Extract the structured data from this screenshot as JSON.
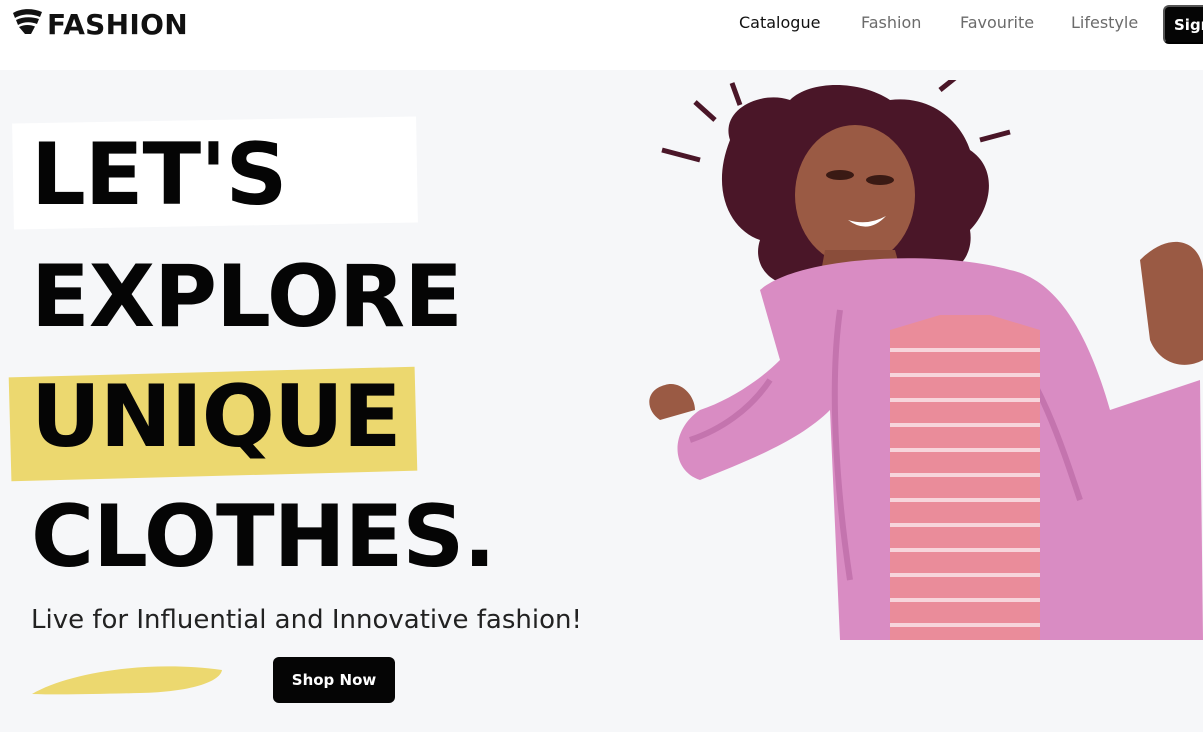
{
  "brand": {
    "name": "FASHION"
  },
  "nav": {
    "links": [
      {
        "label": "Catalogue",
        "active": true
      },
      {
        "label": "Fashion",
        "active": false
      },
      {
        "label": "Favourite",
        "active": false
      },
      {
        "label": "Lifestyle",
        "active": false
      }
    ],
    "signup_label": "Sign Up"
  },
  "hero": {
    "headline": [
      "LET'S",
      "EXPLORE",
      "UNIQUE",
      "CLOTHES."
    ],
    "tagline": "Live for Influential and Innovative fashion!",
    "cta_label": "Shop Now"
  },
  "colors": {
    "accent_yellow": "#ecd86f",
    "button_black": "#050505",
    "hero_bg": "#f6f7f9",
    "coat_pink": "#d98cc3"
  },
  "icons": {
    "logo": "wifi-fan-logo-icon"
  }
}
